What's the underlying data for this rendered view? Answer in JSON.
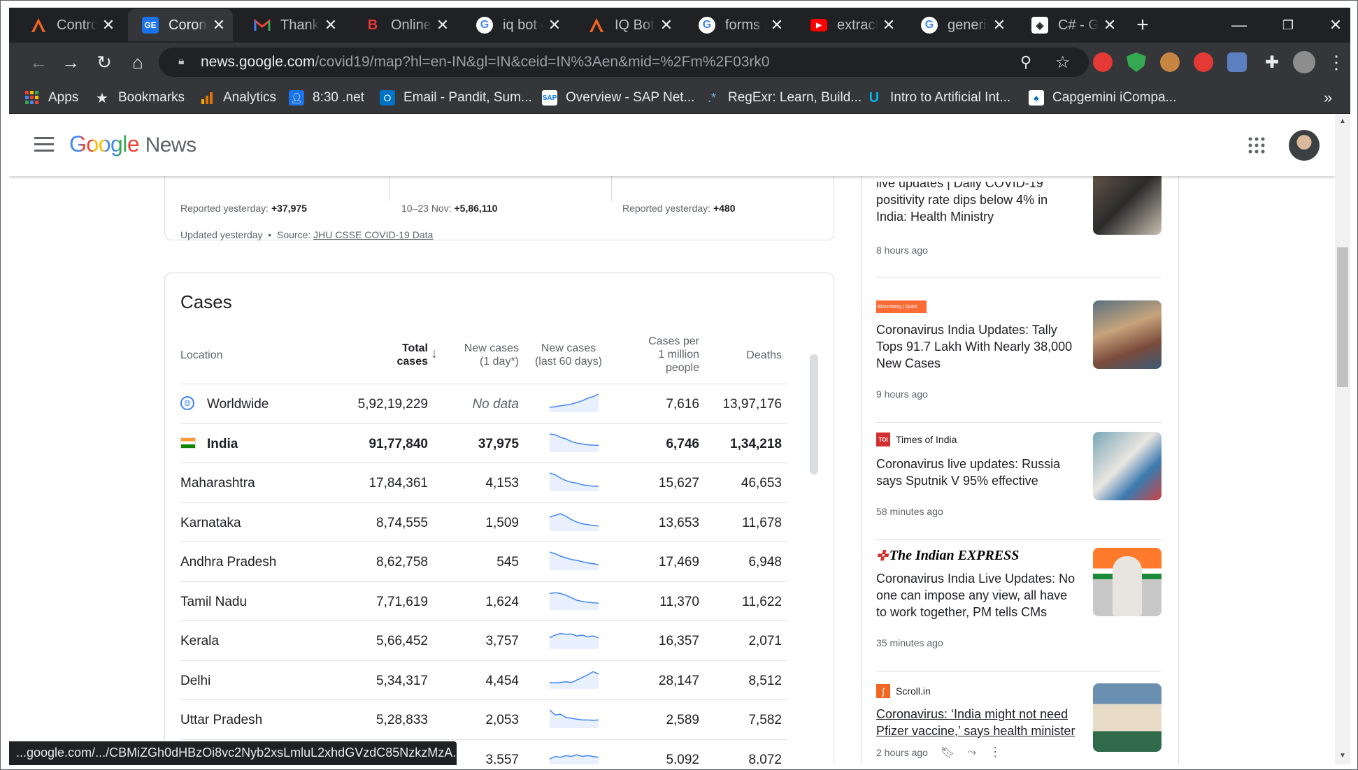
{
  "tabs": [
    {
      "title": "Control",
      "icon": "control-tower-icon"
    },
    {
      "title": "Coronav",
      "icon": "google-news-icon"
    },
    {
      "title": "Thankyc",
      "icon": "gmail-icon"
    },
    {
      "title": "Online I",
      "icon": "blogger-b-icon"
    },
    {
      "title": "iq bot c",
      "icon": "google-g-icon"
    },
    {
      "title": "IQ Bot |",
      "icon": "automation-anywhere-icon"
    },
    {
      "title": "forms ir",
      "icon": "google-g-icon"
    },
    {
      "title": "extracti",
      "icon": "youtube-icon"
    },
    {
      "title": "generic",
      "icon": "google-g-icon"
    },
    {
      "title": "C# - Ge",
      "icon": "csharp-site-icon"
    }
  ],
  "address": {
    "host": "news.google.com",
    "path": "/covid19/map?hl=en-IN&gl=IN&ceid=IN%3Aen&mid=%2Fm%2F03rk0"
  },
  "bookmarks": [
    {
      "label": "Apps",
      "icon": "apps-grid-icon"
    },
    {
      "label": "Bookmarks",
      "icon": "star-icon"
    },
    {
      "label": "Analytics",
      "icon": "analytics-icon"
    },
    {
      "label": "8:30 .net",
      "icon": "contact-card-icon"
    },
    {
      "label": "Email - Pandit, Sum...",
      "icon": "outlook-icon"
    },
    {
      "label": "Overview - SAP Net...",
      "icon": "sap-icon"
    },
    {
      "label": "RegExr: Learn, Build...",
      "icon": "regexr-icon"
    },
    {
      "label": "Intro to Artificial Int...",
      "icon": "udacity-icon"
    },
    {
      "label": "Capgemini iCompa...",
      "icon": "capgemini-icon"
    }
  ],
  "header": {
    "logo_google": "Google",
    "logo_news": "News"
  },
  "summary": {
    "confirmed": "Reported yesterday: ",
    "confirmed_value": "+37,975",
    "recovered": "10–23 Nov: ",
    "recovered_value": "+5,86,110",
    "deaths": "Reported yesterday: ",
    "deaths_value": "+480",
    "updated": "Updated yesterday",
    "source_prefix": "Source: ",
    "source_link": "JHU CSSE COVID-19 Data"
  },
  "cases": {
    "title": "Cases",
    "columns": {
      "location": "Location",
      "total_1": "Total",
      "total_2": "cases",
      "new1_1": "New cases",
      "new1_2": "(1 day*)",
      "new60_1": "New cases",
      "new60_2": "(last 60 days)",
      "permil_1": "Cases per",
      "permil_2": "1 million",
      "permil_3": "people",
      "deaths": "Deaths"
    },
    "rows": [
      {
        "location": "Worldwide",
        "total": "5,92,19,229",
        "new": "No data",
        "per_million": "7,616",
        "deaths": "13,97,176",
        "bold": false,
        "trend": [
          0.2,
          0.25,
          0.3,
          0.35,
          0.4,
          0.5,
          0.6,
          0.75,
          0.85,
          1.0
        ]
      },
      {
        "location": "India",
        "total": "91,77,840",
        "new": "37,975",
        "per_million": "6,746",
        "deaths": "1,34,218",
        "bold": true,
        "trend": [
          1.0,
          0.95,
          0.8,
          0.7,
          0.55,
          0.45,
          0.4,
          0.35,
          0.33,
          0.32
        ]
      },
      {
        "location": "Maharashtra",
        "total": "17,84,361",
        "new": "4,153",
        "per_million": "15,627",
        "deaths": "46,653",
        "bold": false,
        "trend": [
          1.0,
          0.9,
          0.7,
          0.55,
          0.45,
          0.4,
          0.3,
          0.25,
          0.22,
          0.2
        ]
      },
      {
        "location": "Karnataka",
        "total": "8,74,555",
        "new": "1,509",
        "per_million": "13,653",
        "deaths": "11,678",
        "bold": false,
        "trend": [
          0.75,
          0.85,
          0.95,
          0.8,
          0.6,
          0.45,
          0.35,
          0.3,
          0.25,
          0.22
        ]
      },
      {
        "location": "Andhra Pradesh",
        "total": "8,62,758",
        "new": "545",
        "per_million": "17,469",
        "deaths": "6,948",
        "bold": false,
        "trend": [
          1.0,
          0.9,
          0.75,
          0.65,
          0.55,
          0.5,
          0.42,
          0.35,
          0.3,
          0.25
        ]
      },
      {
        "location": "Tamil Nadu",
        "total": "7,71,619",
        "new": "1,624",
        "per_million": "11,370",
        "deaths": "11,622",
        "bold": false,
        "trend": [
          0.9,
          0.95,
          0.9,
          0.8,
          0.65,
          0.5,
          0.42,
          0.38,
          0.35,
          0.32
        ]
      },
      {
        "location": "Kerala",
        "total": "5,66,452",
        "new": "3,757",
        "per_million": "16,357",
        "deaths": "2,071",
        "bold": false,
        "trend": [
          0.6,
          0.75,
          0.85,
          0.8,
          0.82,
          0.7,
          0.75,
          0.65,
          0.7,
          0.6
        ]
      },
      {
        "location": "Delhi",
        "total": "5,34,317",
        "new": "4,454",
        "per_million": "28,147",
        "deaths": "8,512",
        "bold": false,
        "trend": [
          0.3,
          0.28,
          0.3,
          0.35,
          0.3,
          0.45,
          0.6,
          0.75,
          0.95,
          0.8
        ]
      },
      {
        "location": "Uttar Pradesh",
        "total": "5,28,833",
        "new": "2,053",
        "per_million": "2,589",
        "deaths": "7,582",
        "bold": false,
        "trend": [
          1.0,
          0.7,
          0.75,
          0.55,
          0.5,
          0.45,
          0.4,
          0.4,
          0.38,
          0.4
        ]
      },
      {
        "location": "",
        "total": "",
        "new": "3,557",
        "per_million": "5,092",
        "deaths": "8,072",
        "bold": false,
        "trend": [
          0.45,
          0.6,
          0.55,
          0.65,
          0.6,
          0.7,
          0.6,
          0.65,
          0.6,
          0.55
        ]
      }
    ]
  },
  "news": [
    {
      "source": "",
      "headline": "positivity rate dips below 4% in India: Health Ministry",
      "partial": "live updates | Daily COVID-19",
      "time": "8 hours ago"
    },
    {
      "source": "Bloomberg | Quint",
      "headline": "Coronavirus India Updates: Tally Tops 91.7 Lakh With Nearly 38,000 New Cases",
      "time": "9 hours ago"
    },
    {
      "source": "Times of India",
      "headline": "Coronavirus live updates: Russia says Sputnik V 95% effective",
      "time": "58 minutes ago"
    },
    {
      "source": "The Indian EXPRESS",
      "headline": "Coronavirus India Live Updates: No one can impose any view, all have to work together, PM tells CMs",
      "time": "35 minutes ago"
    },
    {
      "source": "Scroll.in",
      "headline": "Coronavirus: ‘India might not need Pfizer vaccine,’ says health minister",
      "time": "2 hours ago"
    }
  ],
  "statusbar": "...google.com/.../CBMiZGh0dHBzOi8vc2Nyb2xsLmluL2xhdGVzdC85NzkzMzA...",
  "colors": {
    "accent": "#1a73e8",
    "spark_line": "#4285f4",
    "spark_fill": "#e8f0fe"
  }
}
